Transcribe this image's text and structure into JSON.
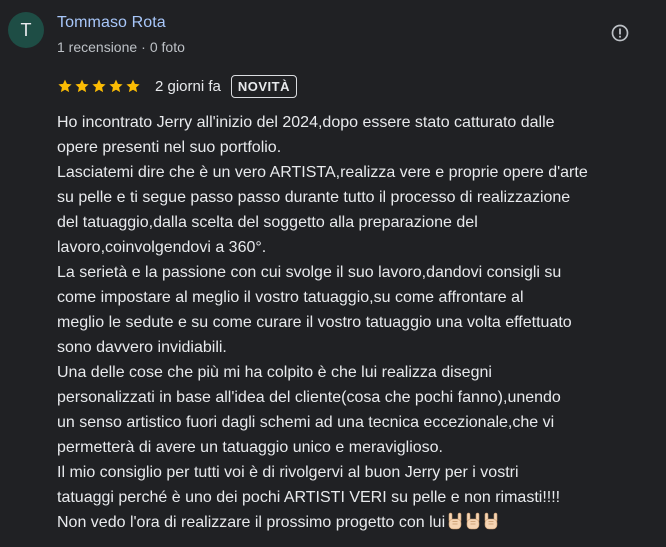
{
  "reviewer": {
    "initial": "T",
    "name": "Tommaso Rota",
    "reviews": "1 recensione",
    "separator": "·",
    "photos": "0 foto",
    "avatar_color": "#1e4d45"
  },
  "rating": {
    "stars": 5,
    "max": 5,
    "star_color": "#fbbc04",
    "date": "2 giorni fa",
    "badge": "NOVITÀ"
  },
  "report_icon": "flag-icon",
  "review_text": [
    "Ho incontrato Jerry all'inizio del 2024,dopo essere stato catturato dalle",
    "opere presenti nel suo portfolio.",
    "Lasciatemi dire che è un vero ARTISTA,realizza vere e proprie opere d'arte",
    "su pelle e ti segue passo passo durante tutto il processo di realizzazione",
    "del tatuaggio,dalla scelta del soggetto alla preparazione del",
    "lavoro,coinvolgendovi a 360°.",
    "La serietà e la passione con cui svolge il suo lavoro,dandovi consigli su",
    "come impostare al meglio il vostro tatuaggio,su come affrontare al",
    "meglio le sedute e su come curare il vostro tatuaggio una volta effettuato",
    "sono davvero invidiabili.",
    "Una delle cose che più mi ha colpito è che lui realizza disegni",
    "personalizzati in base all'idea del cliente(cosa che pochi fanno),unendo",
    "un senso artistico fuori dagli schemi ad una tecnica eccezionale,che vi",
    "permetterà di avere un tatuaggio unico e meraviglioso.",
    "Il mio consiglio per tutti voi è di rivolgervi al buon Jerry per i vostri",
    "tatuaggi perché è uno dei pochi ARTISTI VERI su pelle e non rimasti!!!!",
    "Non vedo l'ora di realizzare il prossimo progetto con lui"
  ],
  "trailing_emoji": [
    "sign-of-horns-icon",
    "sign-of-horns-icon",
    "sign-of-horns-icon"
  ]
}
